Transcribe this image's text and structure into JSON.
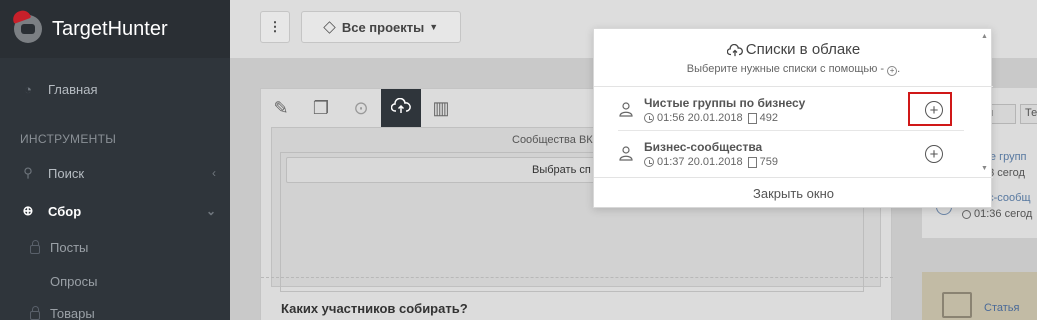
{
  "app": {
    "logo_text": "TargetHunter"
  },
  "sidebar": {
    "main": "Главная",
    "section": "ИНСТРУМЕНТЫ",
    "search": "Поиск",
    "collect": "Сбор",
    "sub": [
      "Посты",
      "Опросы",
      "Товары"
    ]
  },
  "topbar": {
    "menu_label": "⋮",
    "projects_label": "Все проекты"
  },
  "panel": {
    "vk_label": "Сообщества ВК",
    "choose_btn": "Выбрать сп",
    "question": "Каких участников собирать?"
  },
  "rightpanel": {
    "tabs": [
      "рия",
      "Те"
    ],
    "links": [
      "ые групп",
      "ес-сообщ"
    ],
    "times": [
      "43 сегод",
      "01:36 сегод"
    ],
    "article": "Статья"
  },
  "modal": {
    "title": "Списки в облаке",
    "subtitle": "Выберите нужные списки с помощью - ",
    "subtitle_end": ".",
    "items": [
      {
        "name": "Чистые группы по бизнесу",
        "time": "01:56 20.01.2018",
        "count": "492"
      },
      {
        "name": "Бизнес-сообщества",
        "time": "01:37 20.01.2018",
        "count": "759"
      }
    ],
    "close": "Закрыть окно"
  }
}
